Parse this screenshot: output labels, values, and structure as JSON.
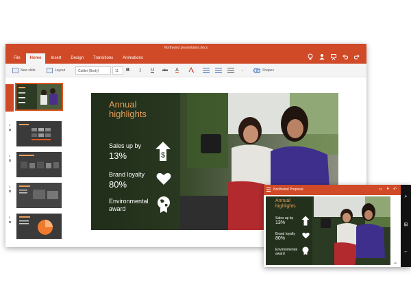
{
  "window": {
    "doc_title": "Northwind presentation.docx"
  },
  "tabs": [
    "File",
    "Home",
    "Insert",
    "Design",
    "Transitions",
    "Animations"
  ],
  "active_tab": "Home",
  "ribbon": {
    "new_slide": "New slide",
    "layout": "Layout",
    "font_name": "Calibri (Body)",
    "font_size": "11",
    "bold": "B",
    "italic": "I",
    "underline": "U",
    "strike": "abc",
    "font_color": "A",
    "shapes": "Shapes"
  },
  "thumbnails": [
    {
      "num": "1"
    },
    {
      "num": "2"
    },
    {
      "num": "3"
    },
    {
      "num": "4"
    },
    {
      "num": "5"
    }
  ],
  "slide": {
    "title_line1": "Annual",
    "title_line2": "highlights",
    "stat1_label": "Sales up by",
    "stat1_value": "13%",
    "stat2_label": "Brand loyalty",
    "stat2_value": "80%",
    "stat3_label_line1": "Environmental",
    "stat3_label_line2": "award"
  },
  "phone": {
    "title": "Northwind Proposal",
    "more": "•••"
  },
  "colors": {
    "accent": "#d04a28",
    "slide_title": "#e8a05a"
  }
}
